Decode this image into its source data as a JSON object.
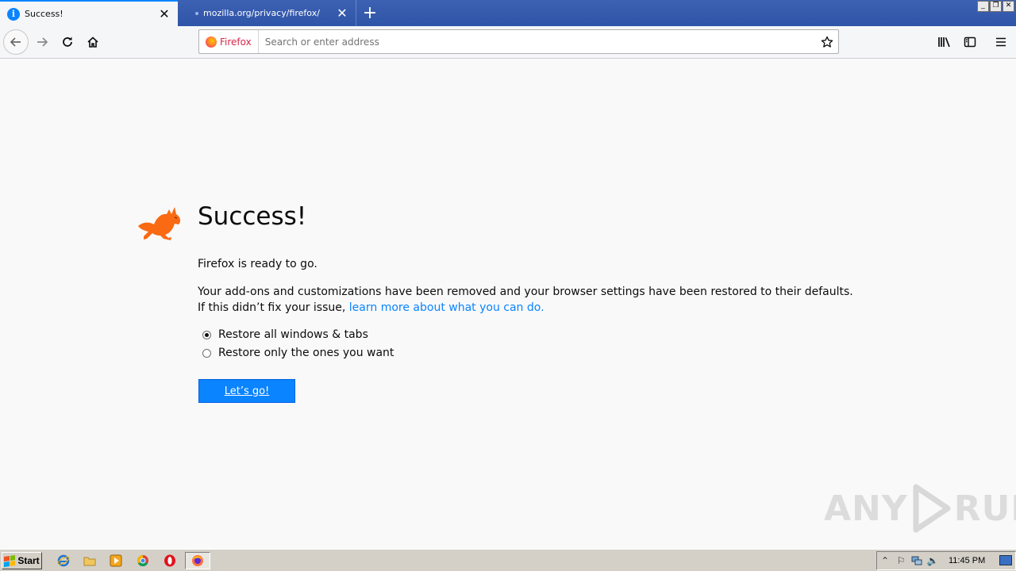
{
  "tabs": [
    {
      "label": "Success!",
      "active": true
    },
    {
      "label": "mozilla.org/privacy/firefox/",
      "active": false
    }
  ],
  "urlbar": {
    "identity_label": "Firefox",
    "placeholder": "Search or enter address",
    "value": ""
  },
  "content": {
    "title": "Success!",
    "ready_text": "Firefox is ready to go.",
    "info_line1": "Your add-ons and customizations have been removed and your browser settings have been restored to their defaults.",
    "info_line2_prefix": "If this didn’t fix your issue, ",
    "learn_more_link": "learn more about what you can do.",
    "options": [
      {
        "label": "Restore all windows & tabs",
        "selected": true
      },
      {
        "label": "Restore only the ones you want",
        "selected": false
      }
    ],
    "go_button": "Let’s go!"
  },
  "watermark": {
    "text_left": "ANY",
    "text_right": "RUN"
  },
  "taskbar": {
    "start_label": "Start",
    "clock": "11:45 PM"
  },
  "colors": {
    "accent": "#0a84ff",
    "fox": "#f96a13",
    "tabstrip": "#3558ab"
  }
}
